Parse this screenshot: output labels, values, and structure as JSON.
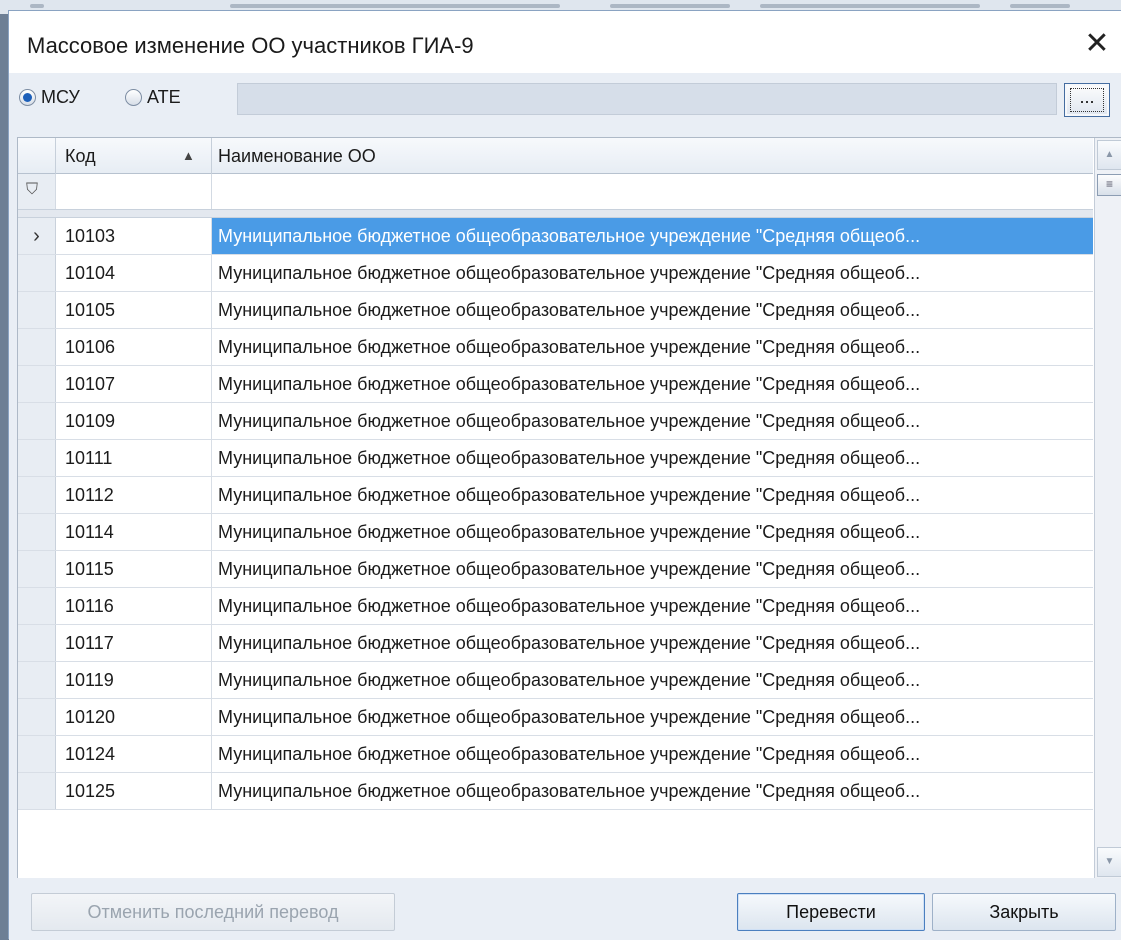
{
  "dialog": {
    "title": "Массовое изменение ОО участников ГИА-9",
    "close_symbol": "✕"
  },
  "toolbar": {
    "radio_msu_label": "МСУ",
    "radio_ate_label": "АТЕ",
    "selected": "МСУ",
    "filter_value": "",
    "browse_label": "..."
  },
  "grid": {
    "columns": [
      {
        "label": "Код",
        "sort": "ascending"
      },
      {
        "label": "Наименование ОО"
      }
    ],
    "sort_icon": "▲",
    "filter_icon_glyph": "⛉",
    "row_indicator_glyph": "›",
    "rows": [
      {
        "code": "10103",
        "name": "Муниципальное бюджетное общеобразовательное учреждение \"Средняя общеоб...",
        "selected": true
      },
      {
        "code": "10104",
        "name": "Муниципальное бюджетное общеобразовательное учреждение \"Средняя общеоб..."
      },
      {
        "code": "10105",
        "name": "Муниципальное бюджетное общеобразовательное учреждение \"Средняя общеоб..."
      },
      {
        "code": "10106",
        "name": "Муниципальное бюджетное общеобразовательное учреждение \"Средняя общеоб..."
      },
      {
        "code": "10107",
        "name": "Муниципальное бюджетное общеобразовательное учреждение \"Средняя общеоб..."
      },
      {
        "code": "10109",
        "name": "Муниципальное бюджетное общеобразовательное учреждение \"Средняя общеоб..."
      },
      {
        "code": "10111",
        "name": "Муниципальное бюджетное общеобразовательное учреждение \"Средняя общеоб..."
      },
      {
        "code": "10112",
        "name": "Муниципальное бюджетное общеобразовательное учреждение \"Средняя общеоб..."
      },
      {
        "code": "10114",
        "name": "Муниципальное бюджетное общеобразовательное учреждение \"Средняя общеоб..."
      },
      {
        "code": "10115",
        "name": "Муниципальное бюджетное общеобразовательное учреждение \"Средняя общеоб..."
      },
      {
        "code": "10116",
        "name": "Муниципальное бюджетное общеобразовательное учреждение \"Средняя общеоб..."
      },
      {
        "code": "10117",
        "name": "Муниципальное бюджетное общеобразовательное учреждение \"Средняя общеоб..."
      },
      {
        "code": "10119",
        "name": "Муниципальное бюджетное общеобразовательное учреждение \"Средняя общеоб..."
      },
      {
        "code": "10120",
        "name": "Муниципальное бюджетное общеобразовательное учреждение \"Средняя общеоб..."
      },
      {
        "code": "10124",
        "name": "Муниципальное бюджетное общеобразовательное учреждение \"Средняя общеоб..."
      },
      {
        "code": "10125",
        "name": "Муниципальное бюджетное общеобразовательное учреждение \"Средняя общеоб..."
      }
    ]
  },
  "footer": {
    "undo_label": "Отменить последний перевод",
    "transfer_label": "Перевести",
    "close_label": "Закрыть"
  },
  "colors": {
    "selection": "#4a9be6",
    "panel": "#e9eef5",
    "border": "#8aa3c2"
  }
}
